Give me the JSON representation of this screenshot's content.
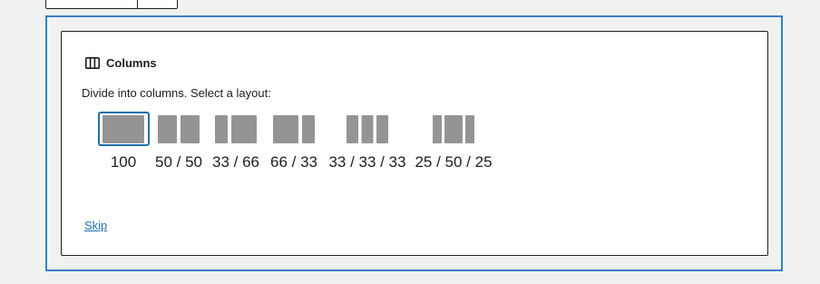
{
  "block": {
    "label": "Columns",
    "icon": "columns-icon",
    "instructions": "Divide into columns. Select a layout:",
    "skip_label": "Skip"
  },
  "variations": [
    {
      "label": "100",
      "selected": true
    },
    {
      "label": "50 / 50",
      "selected": false
    },
    {
      "label": "33 / 66",
      "selected": false
    },
    {
      "label": "66 / 33",
      "selected": false
    },
    {
      "label": "33 / 33 / 33",
      "selected": false
    },
    {
      "label": "25 / 50 / 25",
      "selected": false
    }
  ],
  "colors": {
    "outline": "#3a7fc4",
    "selected": "#1d6fa8",
    "preview": "#949494",
    "link": "#2271b1"
  }
}
